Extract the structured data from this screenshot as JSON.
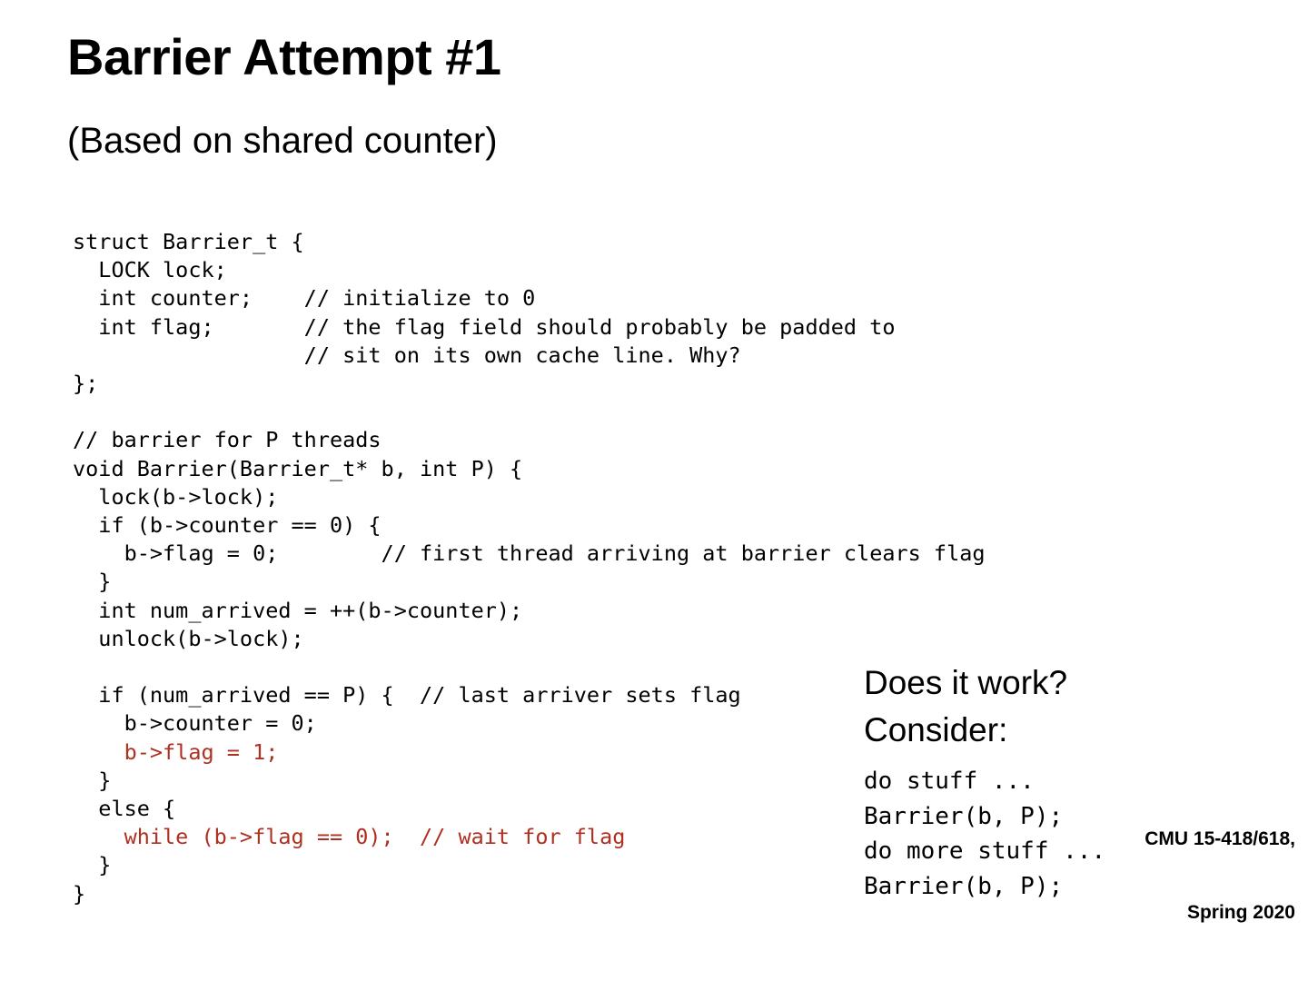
{
  "slide": {
    "title": "Barrier Attempt #1",
    "subtitle": "(Based on shared counter)",
    "background_color": "#FFFFFF",
    "text_color": "#000000",
    "accent_color": "#AE3021"
  },
  "code": {
    "struct_block": [
      "struct Barrier_t {",
      "  LOCK lock;",
      "  int counter;    // initialize to 0",
      "  int flag;       // the flag field should probably be padded to",
      "                  // sit on its own cache line. Why?",
      "};"
    ],
    "function_block": [
      "// barrier for P threads",
      "void Barrier(Barrier_t* b, int P) {",
      "  lock(b->lock);",
      "  if (b->counter == 0) {",
      "    b->flag = 0;        // first thread arriving at barrier clears flag",
      "  }",
      "  int num_arrived = ++(b->counter);",
      "  unlock(b->lock);"
    ],
    "tail_block": [
      {
        "text": "  if (num_arrived == P) {  // last arriver sets flag",
        "color": "black"
      },
      {
        "text": "    b->counter = 0;",
        "color": "black"
      },
      {
        "text": "    b->flag = 1;",
        "color": "red"
      },
      {
        "text": "  }",
        "color": "black"
      },
      {
        "text": "  else {",
        "color": "black"
      },
      {
        "text": "    while (b->flag == 0);  // wait for flag",
        "color": "red"
      },
      {
        "text": "  }",
        "color": "black"
      },
      {
        "text": "}",
        "color": "black"
      }
    ]
  },
  "question": {
    "line1": "Does it work?",
    "line2": "Consider:",
    "example": [
      "do stuff ...",
      "Barrier(b, P);",
      "do more stuff ...",
      "Barrier(b, P);"
    ]
  },
  "footer": {
    "line1": "CMU 15-418/618,",
    "line2": "Spring 2020"
  }
}
